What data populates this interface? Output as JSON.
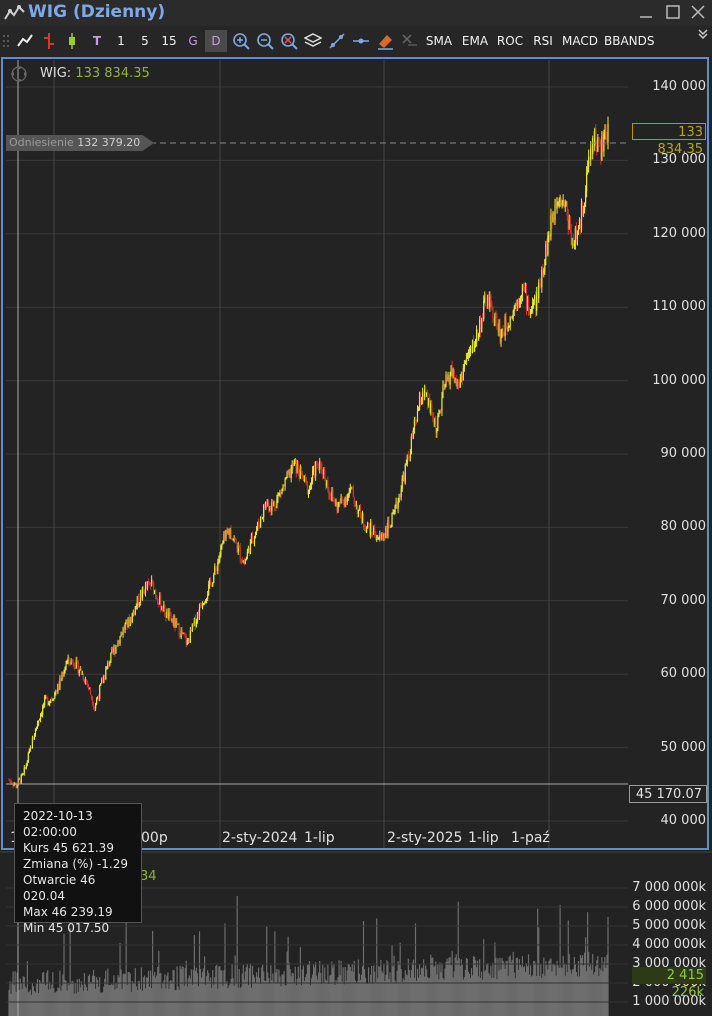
{
  "window": {
    "title": "WIG (Dzienny)"
  },
  "toolbar": {
    "intervals": [
      "1",
      "5",
      "15",
      "G",
      "D"
    ],
    "selected_interval": "D",
    "indicators": [
      "SMA",
      "EMA",
      "ROC",
      "RSI",
      "MACD",
      "BBANDS"
    ]
  },
  "main": {
    "legend_name": "WIG:",
    "legend_value": "133 834.35",
    "current_price_label": "133 834.35",
    "reference_name": "Odniesienie",
    "reference_value": "132 379.20",
    "crosshair_price": "45 170.07"
  },
  "tooltip": {
    "date": "2022-10-13",
    "time": "02:00:00",
    "rows": [
      "Kurs  45 621.39",
      "Zmiana (%)  -1.29",
      "Otwarcie  46 020.04",
      "Max  46 239.19",
      "Min  45 017.50"
    ]
  },
  "volume_panel": {
    "legend_value": "34",
    "current_label": "2 415 226k",
    "y_ticks": [
      "7 000 000k",
      "6 000 000k",
      "5 000 000k",
      "4 000 000k",
      "3 000 000k",
      "2 000 000k",
      "1 000 000k"
    ]
  },
  "chart_data": {
    "type": "candlestick",
    "y_ticks": [
      "140 000",
      "130 000",
      "120 000",
      "110 000",
      "100 000",
      "90 000",
      "80 000",
      "70 000",
      "60 000",
      "50 000",
      "40 000"
    ],
    "x_labels": [
      "1",
      "00p",
      "2-sty-2024",
      "1-lip",
      "2-sty-2025",
      "1-lip",
      "1-paź"
    ],
    "ylim": [
      40000,
      140000
    ],
    "colors": {
      "up": "#e8e83a",
      "down": "#c0392b",
      "volume": "#6e6e6e",
      "grid": "#3a3a3a"
    },
    "close": [
      45621,
      44800,
      46200,
      49800,
      53500,
      56200,
      56800,
      58400,
      61600,
      61800,
      60500,
      58700,
      55600,
      58700,
      61600,
      63900,
      66100,
      67400,
      69800,
      71600,
      72300,
      70100,
      68200,
      67200,
      65800,
      64200,
      66900,
      69800,
      71600,
      74300,
      77900,
      79600,
      77300,
      75100,
      78200,
      80400,
      83300,
      82900,
      84600,
      86500,
      88600,
      87000,
      85100,
      88300,
      87900,
      84700,
      82800,
      83900,
      85000,
      82200,
      80200,
      79500,
      78400,
      79800,
      81400,
      85600,
      89500,
      94300,
      98600,
      96200,
      93400,
      98900,
      101300,
      99100,
      102600,
      104400,
      107400,
      111200,
      108700,
      106200,
      108300,
      110300,
      112800,
      109600,
      110900,
      116400,
      121100,
      125800,
      124000,
      119100,
      120500,
      127800,
      133400,
      131500,
      133834
    ]
  }
}
